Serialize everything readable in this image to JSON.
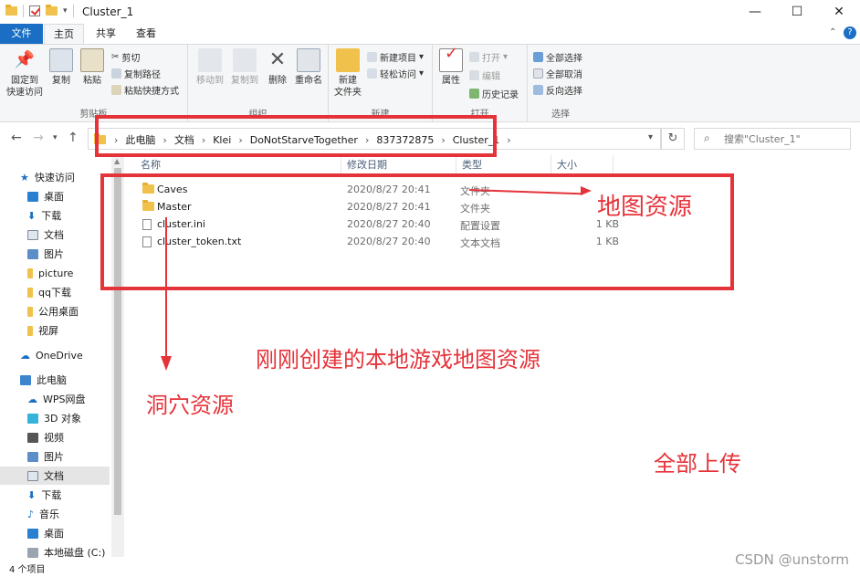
{
  "window": {
    "title": "Cluster_1",
    "controls": {
      "minimize": "—",
      "maximize": "☐",
      "close": "✕"
    }
  },
  "tabs": [
    {
      "label": "文件"
    },
    {
      "label": "主页"
    },
    {
      "label": "共享"
    },
    {
      "label": "查看"
    }
  ],
  "ribbon": {
    "clipboard": {
      "pin": "固定到\n快速访问",
      "copy": "复制",
      "paste": "粘贴",
      "cut": "剪切",
      "copy_path": "复制路径",
      "paste_shortcut": "粘贴快捷方式",
      "group": "剪贴板"
    },
    "organize": {
      "move_to": "移动到",
      "copy_to": "复制到",
      "delete": "删除",
      "rename": "重命名",
      "group": "组织"
    },
    "new": {
      "new_folder": "新建\n文件夹",
      "new_item": "新建项目",
      "easy_access": "轻松访问",
      "group": "新建"
    },
    "open": {
      "properties": "属性",
      "open": "打开",
      "edit": "编辑",
      "history": "历史记录",
      "group": "打开"
    },
    "select": {
      "select_all": "全部选择",
      "select_none": "全部取消",
      "invert": "反向选择",
      "group": "选择"
    }
  },
  "address": {
    "crumbs": [
      "此电脑",
      "文档",
      "Klei",
      "DoNotStarveTogether",
      "837372875",
      "Cluster_1"
    ],
    "search_placeholder": "搜索\"Cluster_1\""
  },
  "sidebar": {
    "items": [
      {
        "label": "快速访问",
        "icon": "star-icon"
      },
      {
        "label": "桌面",
        "icon": "desktop-icon"
      },
      {
        "label": "下载",
        "icon": "download-icon"
      },
      {
        "label": "文档",
        "icon": "document-icon"
      },
      {
        "label": "图片",
        "icon": "picture-icon"
      },
      {
        "label": "picture",
        "icon": "folder-icon"
      },
      {
        "label": "qq下载",
        "icon": "folder-icon"
      },
      {
        "label": "公用桌面",
        "icon": "folder-icon"
      },
      {
        "label": "视屏",
        "icon": "folder-icon"
      },
      {
        "label": "OneDrive",
        "icon": "cloud-icon"
      },
      {
        "label": "此电脑",
        "icon": "computer-icon"
      },
      {
        "label": "WPS网盘",
        "icon": "cloud-icon"
      },
      {
        "label": "3D 对象",
        "icon": "cube-icon"
      },
      {
        "label": "视频",
        "icon": "video-icon"
      },
      {
        "label": "图片",
        "icon": "picture-icon"
      },
      {
        "label": "文档",
        "icon": "document-icon"
      },
      {
        "label": "下载",
        "icon": "download-icon"
      },
      {
        "label": "音乐",
        "icon": "music-icon"
      },
      {
        "label": "桌面",
        "icon": "desktop-icon"
      },
      {
        "label": "本地磁盘 (C:)",
        "icon": "drive-icon"
      }
    ]
  },
  "columns": {
    "name": "名称",
    "modified": "修改日期",
    "type": "类型",
    "size": "大小"
  },
  "files": [
    {
      "name": "Caves",
      "modified": "2020/8/27 20:41",
      "type": "文件夹",
      "size": ""
    },
    {
      "name": "Master",
      "modified": "2020/8/27 20:41",
      "type": "文件夹",
      "size": ""
    },
    {
      "name": "cluster.ini",
      "modified": "2020/8/27 20:40",
      "type": "配置设置",
      "size": "1 KB"
    },
    {
      "name": "cluster_token.txt",
      "modified": "2020/8/27 20:40",
      "type": "文本文档",
      "size": "1 KB"
    }
  ],
  "status": {
    "count": "4 个项目"
  },
  "annotations": {
    "map_resources": "地图资源",
    "new_local_map": "刚刚创建的本地游戏地图资源",
    "caves": "洞穴资源",
    "upload_all": "全部上传",
    "watermark": "CSDN @unstorm"
  },
  "colors": {
    "accent": "#1a6fc4",
    "annotation": "#e5333a",
    "folder": "#f1c24b"
  }
}
